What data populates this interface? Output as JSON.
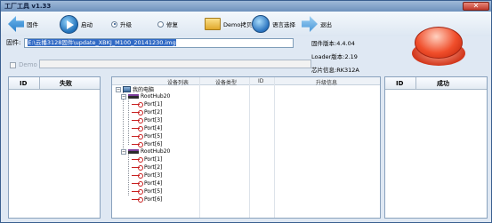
{
  "window": {
    "title": "工厂工具 v1.33",
    "close_symbol": "✕"
  },
  "toolbar": {
    "firmware_label": "固件",
    "start_label": "启动",
    "upgrade_label": "升级",
    "repair_label": "修复",
    "demo_label": "Demo拷贝",
    "language_label": "语言选择",
    "exit_label": "退出",
    "selected_mode": "升级"
  },
  "firmware": {
    "label": "固件:",
    "path": "E:\\云播3128固件\\update_XBKJ_M100_20141230.img"
  },
  "info": {
    "firmware_version": "固件版本:4.4.04",
    "loader_version": "Loader版本:2.19",
    "chip_info": "芯片信息:RK312A"
  },
  "demo": {
    "label": "Demo",
    "value": ""
  },
  "fail_panel": {
    "col_id": "ID",
    "col_title": "失败"
  },
  "success_panel": {
    "col_id": "ID",
    "col_title": "成功"
  },
  "device_tree": {
    "columns": [
      "设备列表",
      "设备类型",
      "ID",
      "升级信息"
    ],
    "root": "我的电脑",
    "hubs": [
      {
        "name": "RootHub20",
        "ports": [
          "Port[1]",
          "Port[2]",
          "Port[3]",
          "Port[4]",
          "Port[5]",
          "Port[6]"
        ]
      },
      {
        "name": "RootHub20",
        "ports": [
          "Port[1]",
          "Port[2]",
          "Port[3]",
          "Port[4]",
          "Port[5]",
          "Port[6]"
        ]
      }
    ]
  }
}
